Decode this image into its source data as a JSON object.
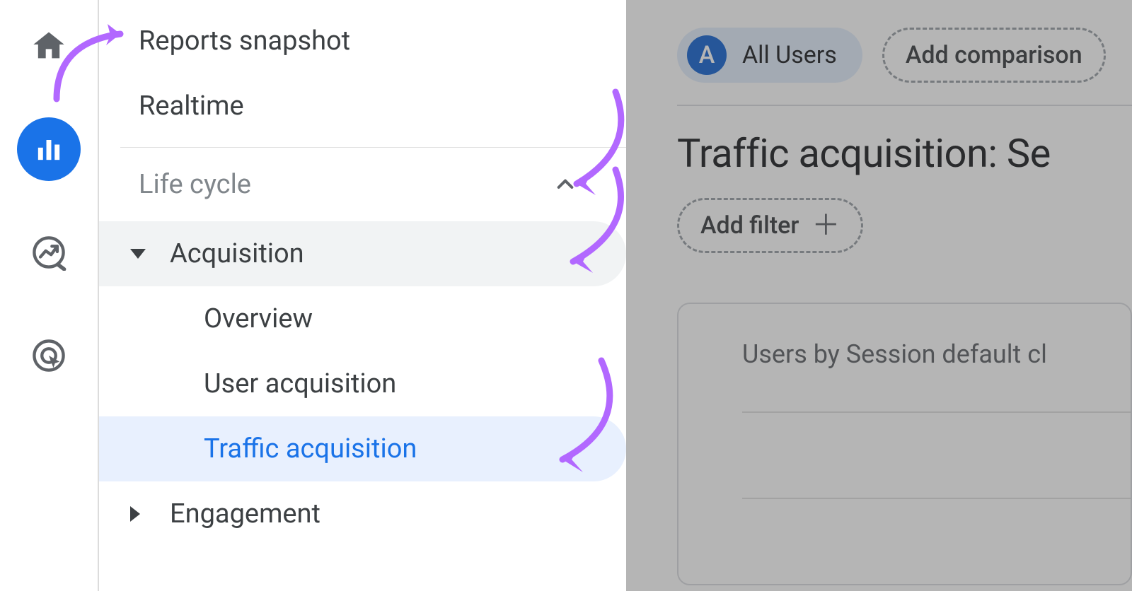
{
  "rail": {
    "home": "Home",
    "reports": "Reports",
    "explore": "Explore",
    "advertising": "Advertising"
  },
  "nav": {
    "snapshot": "Reports snapshot",
    "realtime": "Realtime",
    "lifecycle_header": "Life cycle",
    "acquisition": "Acquisition",
    "acquisition_items": {
      "overview": "Overview",
      "user_acq": "User acquisition",
      "traffic_acq": "Traffic acquisition"
    },
    "engagement": "Engagement"
  },
  "main": {
    "audience_badge": "A",
    "audience_label": "All Users",
    "add_comparison": "Add comparison",
    "title": "Traffic acquisition: Se",
    "add_filter": "Add filter",
    "card_title": "Users by Session default cl"
  }
}
